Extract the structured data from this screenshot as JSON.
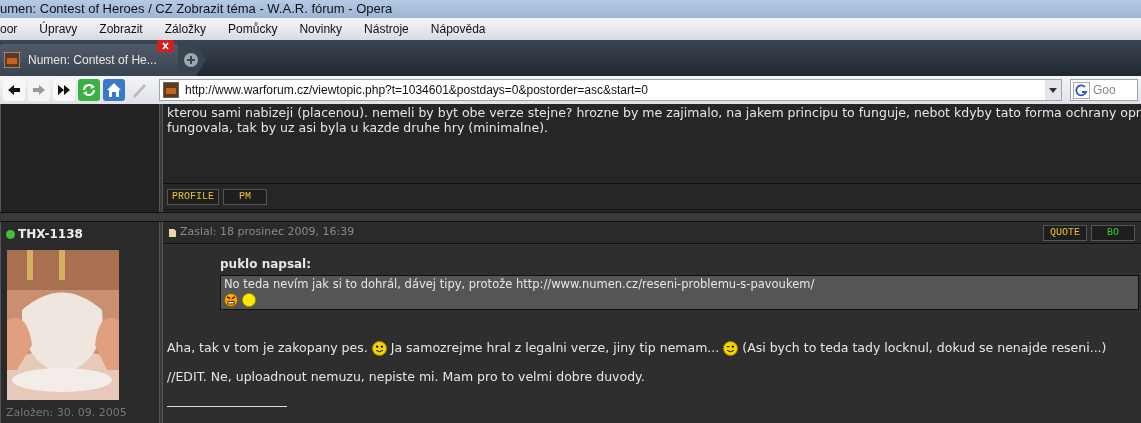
{
  "window": {
    "title": "umen: Contest of Heroes / CZ Zobrazit téma - W.A.R. fórum - Opera"
  },
  "menu": [
    "oor",
    "Úpravy",
    "Zobrazit",
    "Záložky",
    "Pomůcky",
    "Novinky",
    "Nástroje",
    "Nápověda"
  ],
  "tabs": [
    {
      "label": "Numen: Contest of He...",
      "selected": true
    }
  ],
  "address": {
    "url": "http://www.warforum.cz/viewtopic.php?t=1034601&postdays=0&postorder=asc&start=0"
  },
  "search": {
    "placeholder": "Goo"
  },
  "posts": [
    {
      "lines": [
        "kterou sami nabizeji (placenou). nemeli by byt obe verze stejne? hrozne by me zajimalo, na jakem principu to funguje, nebot kdyby tato forma ochrany opr",
        "fungovala, tak by uz asi byla u kazde druhe hry (minimalne)."
      ],
      "buttons": [
        {
          "label": "PROFILE",
          "color": "#e8c030"
        },
        {
          "label": "PM",
          "color": "#e8c030"
        }
      ]
    },
    {
      "author": "THX-1138",
      "online": true,
      "avatar": {
        "kind": "picture"
      },
      "joined": "Založen: 30. 09. 2005",
      "header": "Zaslal: 18 prosinec 2009, 16:39",
      "buttons": [
        {
          "label": "QUOTE",
          "color": "#e8c030"
        },
        {
          "label": "BO",
          "color": "#30d030"
        }
      ],
      "quote": {
        "title": "puklo napsal:",
        "text": "No teda nevím jak si to dohrál, dávej tipy, protože http://www.numen.cz/reseni-problemu-s-pavoukem/",
        "smileys": [
          {
            "kind": "angry"
          },
          {
            "kind": "dot"
          }
        ]
      },
      "paragraphs": [
        [
          {
            "kind": "text",
            "text": "Aha, tak v tom je zakopany pes."
          },
          {
            "kind": "smile"
          },
          {
            "kind": "text",
            "text": "Ja samozrejme hral z legalni verze, jiny tip nemam..."
          },
          {
            "kind": "wink"
          },
          {
            "kind": "text",
            "text": "(Asi bych to teda tady locknul, dokud se nenajde reseni...)"
          }
        ],
        [
          {
            "kind": "text",
            "text": "//EDIT. Ne, uploadnout nemuzu, nepiste mi. Mam pro to velmi dobre duvody."
          }
        ]
      ]
    }
  ]
}
